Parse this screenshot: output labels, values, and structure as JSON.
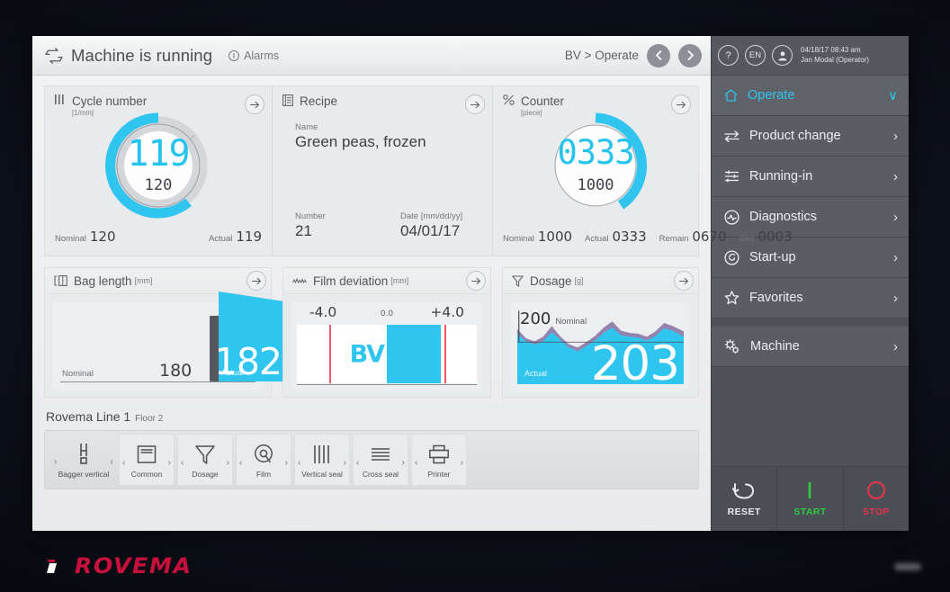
{
  "statusbar": {
    "machine_state": "Machine is running",
    "alarms_label": "Alarms",
    "breadcrumb": "BV > Operate",
    "prev_icon": "chevron-left-icon",
    "next_icon": "chevron-right-icon"
  },
  "sidebar_top": {
    "help": "?",
    "language": "EN",
    "datetime": "04/18/17 08:43 am",
    "user": "Jan Modal (Operator)"
  },
  "sidebar": {
    "items": [
      {
        "label": "Operate",
        "icon": "home-icon",
        "chevron": "∨",
        "current": true
      },
      {
        "label": "Product change",
        "icon": "exchange-icon",
        "chevron": "›",
        "current": false
      },
      {
        "label": "Running-in",
        "icon": "sliders-icon",
        "chevron": "›",
        "current": false
      },
      {
        "label": "Diagnostics",
        "icon": "pulse-circle-icon",
        "chevron": "›",
        "current": false
      },
      {
        "label": "Start-up",
        "icon": "power-spiral-icon",
        "chevron": "›",
        "current": false
      },
      {
        "label": "Favorites",
        "icon": "star-icon",
        "chevron": "›",
        "current": false
      }
    ],
    "machine": {
      "label": "Machine",
      "icon": "gears-icon",
      "chevron": "›"
    }
  },
  "controls": [
    {
      "label": "RESET",
      "icon": "undo-arrow-icon",
      "color": "#e8eaec"
    },
    {
      "label": "START",
      "icon": "start-bar-icon",
      "color": "#2ecc40"
    },
    {
      "label": "STOP",
      "icon": "stop-circle-icon",
      "color": "#e8344b"
    }
  ],
  "cards": {
    "cycle": {
      "title": "Cycle number",
      "unit": "[1/min]",
      "icon": "bars-icon",
      "arrow": "arrow-right-icon",
      "value": "119",
      "sub": "120",
      "nominal_label": "Nominal",
      "nominal_value": "120",
      "actual_label": "Actual",
      "actual_value": "119"
    },
    "recipe": {
      "title": "Recipe",
      "icon": "document-icon",
      "arrow": "arrow-right-icon",
      "name_label": "Name",
      "name_value": "Green peas, frozen",
      "number_label": "Number",
      "number_value": "21",
      "date_label": "Date [mm/dd/yy]",
      "date_value": "04/01/17"
    },
    "counter": {
      "title": "Counter",
      "unit": "[piece]",
      "icon": "percent-icon",
      "arrow": "arrow-right-icon",
      "value": "0333",
      "sub": "1000",
      "nominal_label": "Nominal",
      "nominal_value": "1000",
      "actual_label": "Actual",
      "actual_value": "0333",
      "remain_label": "Remain",
      "remain_value": "0670",
      "bad_label": "Bad",
      "bad_value": "0003"
    },
    "bag_length": {
      "title": "Bag length",
      "unit": "[mm]",
      "icon": "bag-length-icon",
      "arrow": "arrow-right-icon",
      "nominal_label": "Nominal",
      "nominal_value": "180",
      "actual_label": "Actual",
      "actual_value": "182"
    },
    "film_deviation": {
      "title": "Film deviation",
      "unit": "[mm]",
      "icon": "waveform-icon",
      "arrow": "arrow-right-icon",
      "min_label": "-4.0",
      "mid_label": "0.0",
      "max_label": "+4.0",
      "bar_label": "BV"
    },
    "dosage": {
      "title": "Dosage",
      "unit": "[g]",
      "icon": "funnel-icon",
      "arrow": "arrow-right-icon",
      "nominal_value": "200",
      "nominal_label": "Nominal",
      "actual_label": "Actual",
      "actual_value": "203"
    }
  },
  "machine_bar": {
    "title": "Rovema Line 1",
    "subtitle": "Floor 2",
    "items": [
      {
        "label": "Bagger vertical",
        "icon": "bagger-vertical-icon",
        "raised": false
      },
      {
        "label": "Common",
        "icon": "common-panel-icon",
        "raised": true
      },
      {
        "label": "Dosage",
        "icon": "funnel-icon",
        "raised": true
      },
      {
        "label": "Film",
        "icon": "film-reel-icon",
        "raised": true
      },
      {
        "label": "Vertical seal",
        "icon": "vertical-seal-icon",
        "raised": true
      },
      {
        "label": "Cross seal",
        "icon": "cross-seal-icon",
        "raised": true
      },
      {
        "label": "Printer",
        "icon": "printer-icon",
        "raised": true
      }
    ]
  },
  "brand": {
    "name": "ROVEMA",
    "color": "#c8103c"
  },
  "chart_data": [
    {
      "type": "pie",
      "name": "cycle-number-gauge",
      "title": "Cycle number [1/min]",
      "values": [
        119
      ],
      "max": 120,
      "unit": "1/min",
      "center_value": "119",
      "center_sub": "120"
    },
    {
      "type": "pie",
      "name": "counter-gauge",
      "title": "Counter [piece]",
      "values": [
        333
      ],
      "max": 1000,
      "unit": "piece",
      "center_value": "0333",
      "center_sub": "1000"
    },
    {
      "type": "bar",
      "name": "bag-length",
      "title": "Bag length [mm]",
      "categories": [
        "Nominal",
        "Actual"
      ],
      "values": [
        180,
        182
      ],
      "ylabel": "mm"
    },
    {
      "type": "bar",
      "name": "film-deviation",
      "title": "Film deviation [mm]",
      "categories": [
        "BV"
      ],
      "values": [
        2.0
      ],
      "xlim": [
        -4.0,
        4.0
      ],
      "ticks": [
        "-4.0",
        "0.0",
        "+4.0"
      ],
      "limits": [
        -3.2,
        3.2
      ]
    },
    {
      "type": "area",
      "name": "dosage-trend",
      "title": "Dosage [g]",
      "ylabel": "g",
      "nominal": 200,
      "actual": 203,
      "series": [
        {
          "name": "Actual",
          "values": [
            208,
            200,
            196,
            202,
            214,
            200,
            190,
            186,
            193,
            201,
            210,
            218,
            207,
            204,
            203,
            200,
            206,
            216,
            212,
            205
          ]
        },
        {
          "name": "Nominal",
          "values": [
            200,
            200,
            200,
            200,
            200,
            200,
            200,
            200,
            200,
            200,
            200,
            200,
            200,
            200,
            200,
            200,
            200,
            200,
            200,
            200
          ]
        }
      ]
    }
  ]
}
